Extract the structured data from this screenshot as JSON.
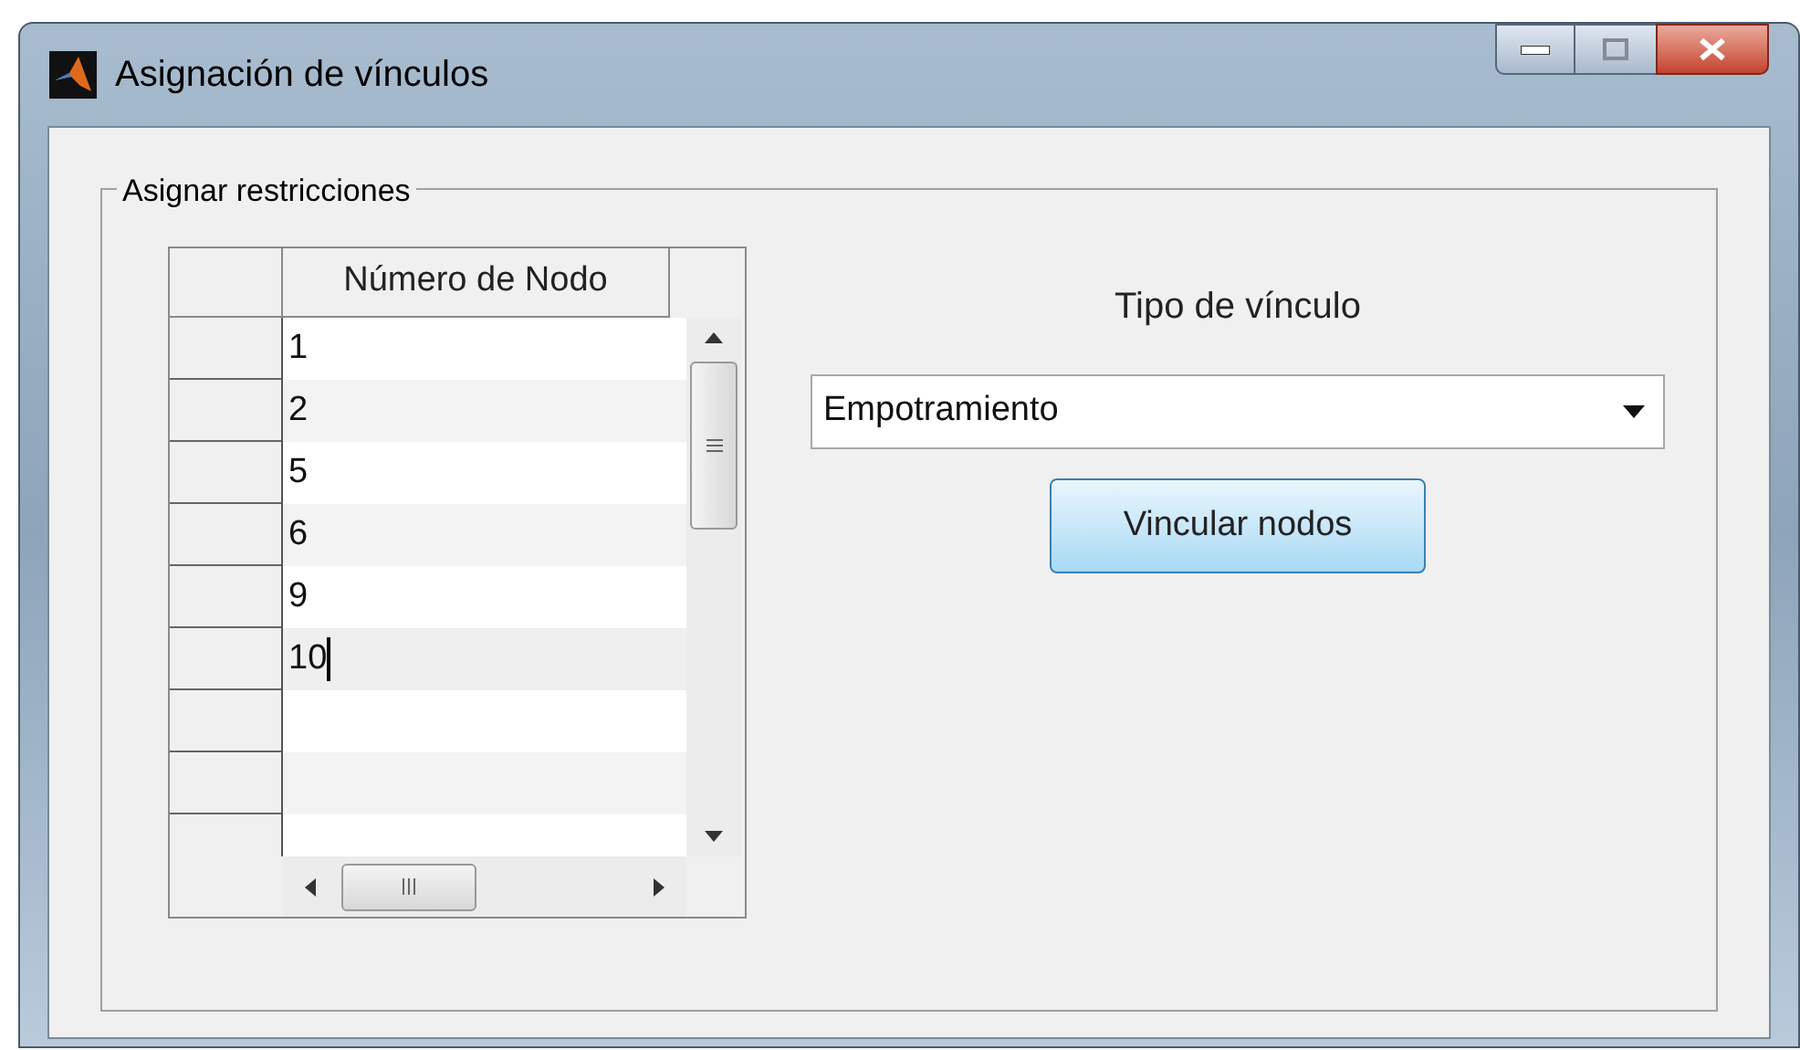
{
  "window": {
    "title": "Asignación de vínculos"
  },
  "group": {
    "title": "Asignar restricciones"
  },
  "table": {
    "columns": [
      "Número de Nodo"
    ],
    "rows": [
      {
        "value": "1",
        "editing": false
      },
      {
        "value": "2",
        "editing": false
      },
      {
        "value": "5",
        "editing": false
      },
      {
        "value": "6",
        "editing": false
      },
      {
        "value": "9",
        "editing": false
      },
      {
        "value": "10",
        "editing": true
      }
    ]
  },
  "link_type": {
    "label": "Tipo de vínculo",
    "value": "Empotramiento"
  },
  "buttons": [
    "Vincular nodos"
  ]
}
